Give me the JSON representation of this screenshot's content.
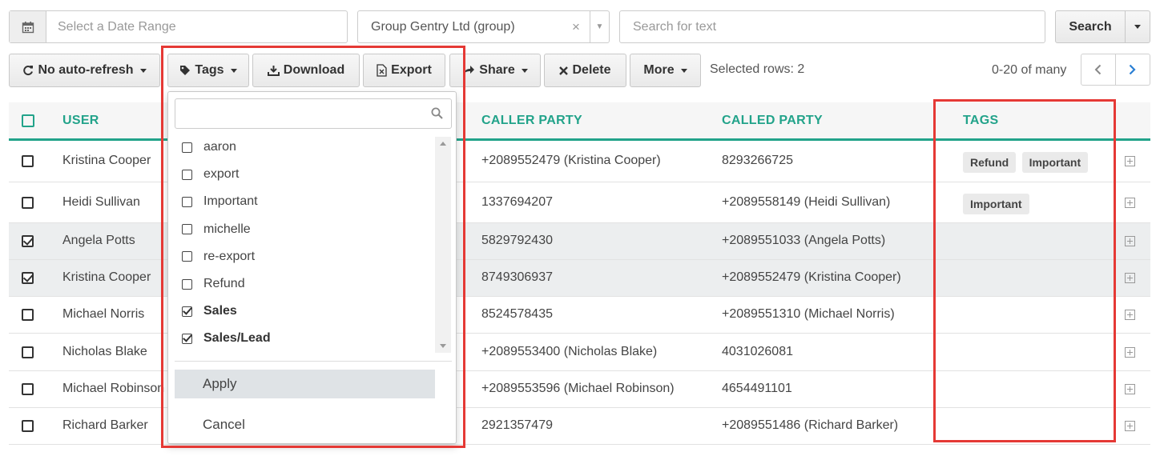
{
  "filters": {
    "date_placeholder": "Select a Date Range",
    "group_value": "Group Gentry Ltd (group)",
    "group_clear": "×",
    "search_placeholder": "Search for text",
    "search_label": "Search"
  },
  "toolbar": {
    "refresh_label": "No auto-refresh",
    "tags_label": "Tags",
    "download_label": "Download",
    "export_label": "Export",
    "share_label": "Share",
    "delete_label": "Delete",
    "more_label": "More",
    "selected_rows": "Selected rows: 2",
    "pager_text": "0-20 of many"
  },
  "table": {
    "columns": {
      "user": "USER",
      "caller": "CALLER PARTY",
      "called": "CALLED PARTY",
      "tags": "TAGS"
    },
    "rows": [
      {
        "user": "Kristina Cooper",
        "caller": "+2089552479 (Kristina Cooper)",
        "called": "8293266725",
        "checked": false,
        "tags": [
          "Refund",
          "Important"
        ]
      },
      {
        "user": "Heidi Sullivan",
        "caller": "1337694207",
        "called": "+2089558149 (Heidi Sullivan)",
        "checked": false,
        "tags": [
          "Important"
        ]
      },
      {
        "user": "Angela Potts",
        "caller": "5829792430",
        "called": "+2089551033 (Angela Potts)",
        "checked": true,
        "tags": []
      },
      {
        "user": "Kristina Cooper",
        "caller": "8749306937",
        "called": "+2089552479 (Kristina Cooper)",
        "checked": true,
        "tags": []
      },
      {
        "user": "Michael Norris",
        "caller": "8524578435",
        "called": "+2089551310 (Michael Norris)",
        "checked": false,
        "tags": []
      },
      {
        "user": "Nicholas Blake",
        "caller": "+2089553400 (Nicholas Blake)",
        "called": "4031026081",
        "checked": false,
        "tags": []
      },
      {
        "user": "Michael Robinson",
        "caller": "+2089553596 (Michael Robinson)",
        "called": "4654491101",
        "checked": false,
        "tags": []
      },
      {
        "user": "Richard Barker",
        "caller": "2921357479",
        "called": "+2089551486 (Richard Barker)",
        "checked": false,
        "tags": []
      }
    ]
  },
  "tags_dropdown": {
    "search_value": "",
    "items": [
      {
        "label": "aaron",
        "checked": false
      },
      {
        "label": "export",
        "checked": false
      },
      {
        "label": "Important",
        "checked": false
      },
      {
        "label": "michelle",
        "checked": false
      },
      {
        "label": "re-export",
        "checked": false
      },
      {
        "label": "Refund",
        "checked": false
      },
      {
        "label": "Sales",
        "checked": true
      },
      {
        "label": "Sales/Lead",
        "checked": true
      }
    ],
    "apply_label": "Apply",
    "cancel_label": "Cancel"
  },
  "colors": {
    "accent": "#22a38a",
    "highlight": "#e53935",
    "selected_row": "#eceeef"
  },
  "icons": {
    "date": "calendar-icon",
    "refresh": "refresh-icon",
    "tags": "tag-icon",
    "download": "download-icon",
    "export": "excel-file-icon",
    "share": "share-arrow-icon",
    "delete": "close-icon",
    "search_in_tags": "search-icon",
    "prev": "chevron-left-icon",
    "next": "chevron-right-icon",
    "expand": "plus-square-icon"
  }
}
